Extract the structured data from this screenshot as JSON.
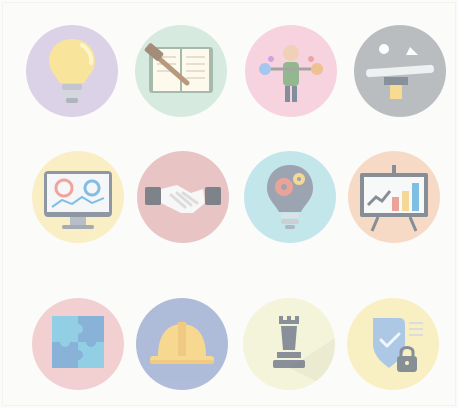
{
  "icons": [
    {
      "name": "lightbulb-icon",
      "bg": "#c9b7dc"
    },
    {
      "name": "auction-book-icon",
      "bg": "#bfe0cf"
    },
    {
      "name": "balance-person-icon",
      "bg": "#f4b9cf"
    },
    {
      "name": "desk-tools-icon",
      "bg": "#8f949b"
    },
    {
      "name": "dashboard-monitor-icon",
      "bg": "#fae6a4"
    },
    {
      "name": "handshake-icon",
      "bg": "#dea0a4"
    },
    {
      "name": "idea-gears-icon",
      "bg": "#9fd9e3"
    },
    {
      "name": "growth-chart-icon",
      "bg": "#f6c5a4"
    },
    {
      "name": "puzzle-icon",
      "bg": "#edb3b7"
    },
    {
      "name": "hard-hat-icon",
      "bg": "#7e93c4"
    },
    {
      "name": "chess-rook-icon",
      "bg": "#eef0c4"
    },
    {
      "name": "security-shield-icon",
      "bg": "#f7eaa0"
    }
  ]
}
